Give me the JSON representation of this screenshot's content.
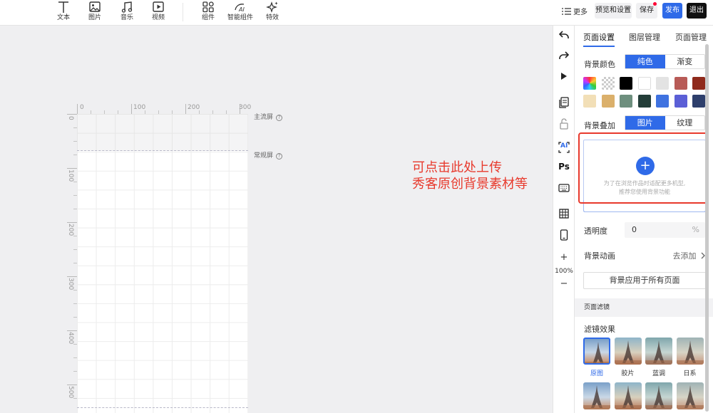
{
  "toolbar": {
    "tools": [
      {
        "label": "文本",
        "icon": "text-icon"
      },
      {
        "label": "图片",
        "icon": "image-icon"
      },
      {
        "label": "音乐",
        "icon": "music-icon"
      },
      {
        "label": "视频",
        "icon": "video-icon"
      },
      {
        "label": "组件",
        "icon": "components-icon"
      },
      {
        "label": "智能组件",
        "icon": "ai-component-icon"
      },
      {
        "label": "特效",
        "icon": "sparkle-icon"
      }
    ],
    "more_label": "更多",
    "preview_label": "预览和设置",
    "save_label": "保存",
    "publish_label": "发布",
    "exit_label": "退出"
  },
  "canvas": {
    "ruler_h_labels": [
      "0",
      "100",
      "200",
      "300"
    ],
    "ruler_v_labels": [
      "0",
      "100",
      "200",
      "300",
      "400",
      "500"
    ],
    "main_screen_label": "主流屏",
    "normal_screen_label": "常规屏",
    "help_glyph": "?"
  },
  "annotation": {
    "line1": "可点击此处上传",
    "line2": "秀客原创背景素材等"
  },
  "side_strip": {
    "icons": [
      "undo-icon",
      "redo-icon",
      "play-icon",
      "pages-icon",
      "lock-icon",
      "ai-icon",
      "ps-icon",
      "keyboard-icon",
      "grid-icon",
      "phone-icon"
    ],
    "ps_text": "Ps",
    "ai_text": "AI",
    "zoom_in": "+",
    "zoom_level": "100%",
    "zoom_out": "−"
  },
  "panel": {
    "tabs": [
      "页面设置",
      "图层管理",
      "页面管理"
    ],
    "bg_color_label": "背景颜色",
    "bg_color_modes": [
      "纯色",
      "渐变"
    ],
    "swatches_row1": [
      "rainbow",
      "transparent",
      "#000000",
      "#ffffff",
      "#e3e3e3",
      "#b85b57",
      "#8f2a1c"
    ],
    "swatches_row2": [
      "#f2dfb7",
      "#dbb06b",
      "#6e8f7e",
      "#233d38",
      "#3f72e0",
      "#5b5fd6",
      "#2e3f6c"
    ],
    "bg_overlay_label": "背景叠加",
    "bg_overlay_modes": [
      "图片",
      "纹理"
    ],
    "upload_plus": "+",
    "upload_hint_line1": "为了在浏览作品时适配更多机型,",
    "upload_hint_line2": "推荐您使用背景功能",
    "opacity_label": "透明度",
    "opacity_value": "0",
    "opacity_unit": "%",
    "bg_anim_label": "背景动画",
    "bg_anim_action": "去添加",
    "apply_all_label": "背景应用于所有页面",
    "filter_section": "页面滤镜",
    "filter_effect_label": "滤镜效果",
    "filters": [
      "原图",
      "胶片",
      "蓝调",
      "日系"
    ],
    "accent_color": "#2f6ae8",
    "highlight_color": "#e8392c"
  }
}
